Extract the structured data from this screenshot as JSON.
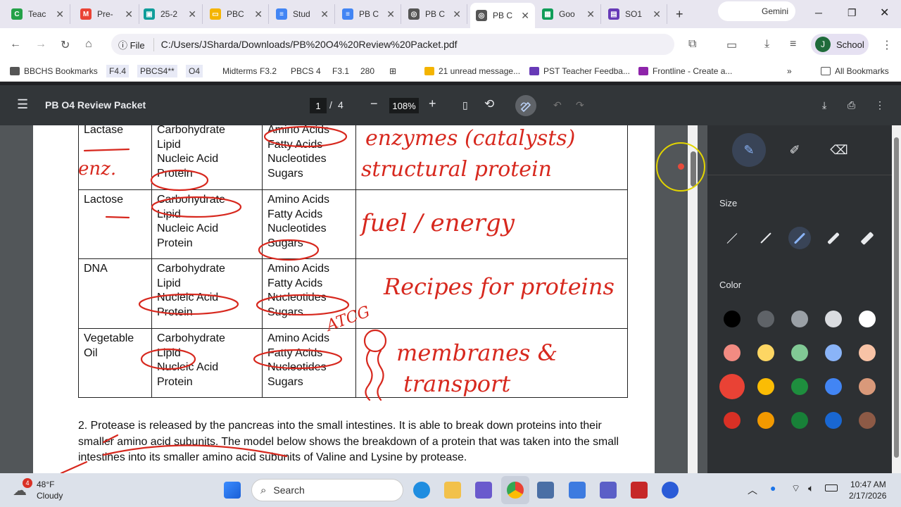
{
  "tabs": [
    {
      "title": "Teac",
      "color": "#24a148",
      "letter": "C"
    },
    {
      "title": "Pre-",
      "color": "#ea4335",
      "letter": "M"
    },
    {
      "title": "25-2",
      "color": "#0f9d9a",
      "letter": "▣"
    },
    {
      "title": "PBC",
      "color": "#f4b400",
      "letter": "▭"
    },
    {
      "title": "Stud",
      "color": "#4285f4",
      "letter": "≡"
    },
    {
      "title": "PB C",
      "color": "#4285f4",
      "letter": "≡"
    },
    {
      "title": "PB C",
      "color": "#555555",
      "letter": "◎"
    },
    {
      "title": "PB C",
      "color": "#555555",
      "letter": "◎"
    },
    {
      "title": "Goo",
      "color": "#0f9d58",
      "letter": "▦"
    },
    {
      "title": "SO1",
      "color": "#673ab7",
      "letter": "▤"
    }
  ],
  "gemini_label": "Gemini",
  "address": {
    "prefix": "File",
    "url": "C:/Users/JSharda/Downloads/PB%20O4%20Review%20Packet.pdf"
  },
  "profile": {
    "initial": "J",
    "label": "School"
  },
  "bookmarks": [
    "BBCHS Bookmarks",
    "F4.4",
    "PBCS4**",
    "O4",
    "Midterms",
    "F3.2",
    "PBCS 4",
    "F3.1",
    "280",
    "21 unread message...",
    "PST Teacher Feedba...",
    "Frontline - Create a..."
  ],
  "all_bookmarks": "All Bookmarks",
  "pdf": {
    "title": "PB O4 Review Packet",
    "page": "1",
    "sep": "/",
    "total": "4",
    "zoom": "108%"
  },
  "table": [
    {
      "molecule": "Lactase",
      "types": [
        "Carbohydrate",
        "Lipid",
        "Nucleic Acid",
        "Protein"
      ],
      "subunits": [
        "Amino Acids",
        "Fatty Acids",
        "Nucleotides",
        "Sugars"
      ]
    },
    {
      "molecule": "Lactose",
      "types": [
        "Carbohydrate",
        "Lipid",
        "Nucleic Acid",
        "Protein"
      ],
      "subunits": [
        "Amino Acids",
        "Fatty Acids",
        "Nucleotides",
        "Sugars"
      ]
    },
    {
      "molecule": "DNA",
      "types": [
        "Carbohydrate",
        "Lipid",
        "Nucleic Acid",
        "Protein"
      ],
      "subunits": [
        "Amino Acids",
        "Fatty Acids",
        "Nucleotides",
        "Sugars"
      ]
    },
    {
      "molecule": "Vegetable Oil",
      "types": [
        "Carbohydrate",
        "Lipid",
        "Nucleic Acid",
        "Protein"
      ],
      "subunits": [
        "Amino Acids",
        "Fatty Acids",
        "Nucleotides",
        "Sugars"
      ]
    }
  ],
  "question2": "2. Protease is released by the pancreas into the small intestines. It is able to break down proteins into their smaller amino acid subunits. The model below shows the breakdown of a protein that was taken into the small intestines into its smaller amino acid subunits of Valine and Lysine by protease.",
  "handwriting": {
    "row1a": "enzymes (catalysts)",
    "row1b": "structural protein",
    "row1c": "enz.",
    "row2": "fuel / energy",
    "row3": "Recipes for proteins",
    "row3b": "ATCG",
    "row4a": "membranes &",
    "row4b": "transport"
  },
  "panel": {
    "size_label": "Size",
    "color_label": "Color",
    "colors": [
      "#000000",
      "#5f6368",
      "#9aa0a6",
      "#dadce0",
      "#ffffff",
      "#f28b82",
      "#fdd663",
      "#81c995",
      "#8ab4f8",
      "#f8c3a6",
      "#e94235",
      "#fbbc04",
      "#1e8e3e",
      "#4285f4",
      "#d9997a",
      "#d93025",
      "#f29900",
      "#188038",
      "#1967d2",
      "#8d5a46"
    ],
    "selected_color": "#e94235"
  },
  "taskbar": {
    "weather_temp": "48°F",
    "weather_desc": "Cloudy",
    "weather_badge": "4",
    "search": "Search",
    "time": "10:47 AM",
    "date": "2/17/2026"
  }
}
